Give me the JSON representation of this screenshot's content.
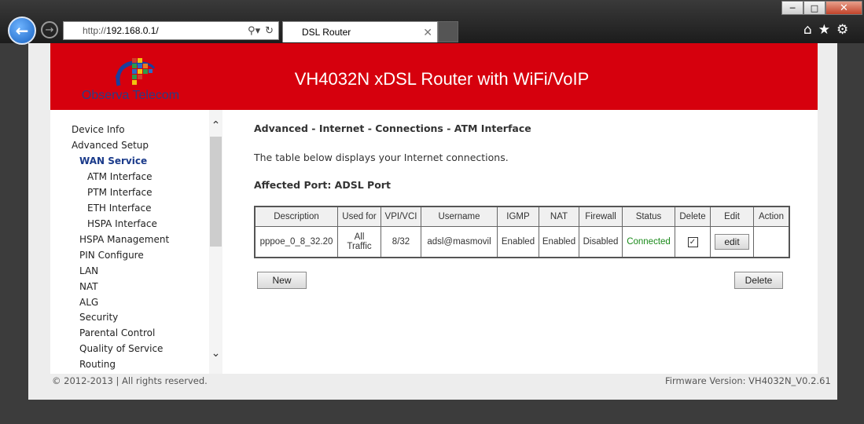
{
  "browser": {
    "url_prefix": "http://",
    "url_host": "192.168.0.1/",
    "tab_title": "DSL Router",
    "icons": [
      "back-icon",
      "forward-icon",
      "search-icon",
      "refresh-icon",
      "home-icon",
      "favorites-star-icon",
      "settings-gear-icon",
      "minimize-icon",
      "maximize-icon",
      "close-icon"
    ]
  },
  "header": {
    "logo_text": "Observa Telecom",
    "title": "VH4032N xDSL Router with WiFi/VoIP",
    "banner_color": "#d6000d"
  },
  "sidebar": {
    "items": [
      {
        "label": "Device Info"
      },
      {
        "label": "Advanced Setup"
      },
      {
        "label": "WAN Service"
      },
      {
        "label": "ATM Interface"
      },
      {
        "label": "PTM Interface"
      },
      {
        "label": "ETH Interface"
      },
      {
        "label": "HSPA Interface"
      },
      {
        "label": "HSPA Management"
      },
      {
        "label": "PIN Configure"
      },
      {
        "label": "LAN"
      },
      {
        "label": "NAT"
      },
      {
        "label": "ALG"
      },
      {
        "label": "Security"
      },
      {
        "label": "Parental Control"
      },
      {
        "label": "Quality of Service"
      },
      {
        "label": "Routing"
      }
    ],
    "active_item": "WAN Service"
  },
  "main": {
    "breadcrumb": "Advanced - Internet - Connections - ATM Interface",
    "description": "The table below displays your Internet connections.",
    "affected_port": "Affected Port: ADSL Port",
    "table": {
      "headers": [
        "Description",
        "Used for",
        "VPI/VCI",
        "Username",
        "IGMP",
        "NAT",
        "Firewall",
        "Status",
        "Delete",
        "Edit",
        "Action"
      ],
      "row": {
        "description": "pppoe_0_8_32.20",
        "used_for_1": "All",
        "used_for_2": "Traffic",
        "vpi_vci": "8/32",
        "username": "adsl@masmovil",
        "igmp": "Enabled",
        "nat": "Enabled",
        "firewall": "Disabled",
        "status": "Connected",
        "delete_checked": true,
        "edit_label": "edit",
        "action": ""
      }
    },
    "new_label": "New",
    "delete_label": "Delete"
  },
  "footer": {
    "copyright": "© 2012-2013 | All rights reserved.",
    "firmware": "Firmware Version: VH4032N_V0.2.61"
  },
  "colors": {
    "status_connected": "#1a8a1a",
    "active_nav": "#1a3a8a"
  }
}
